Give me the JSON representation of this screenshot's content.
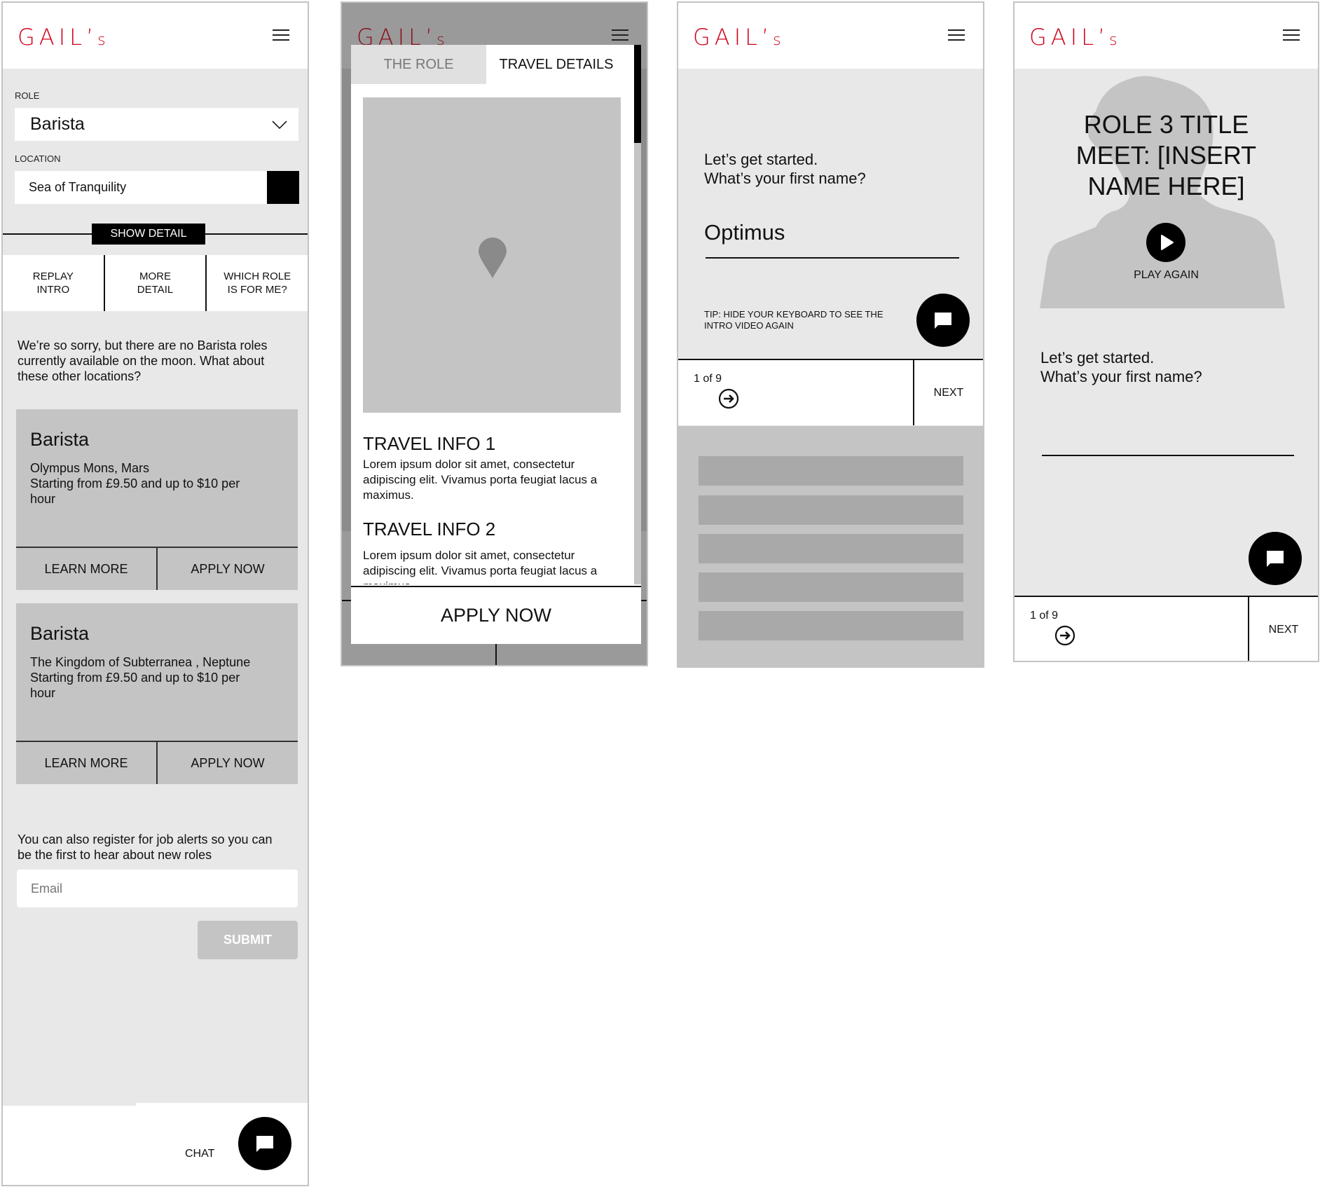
{
  "brand": {
    "logo_main": "GAIL’",
    "logo_suffix": "s",
    "logo_color": "#d0021b"
  },
  "screen1": {
    "role_label": "ROLE",
    "role_value": "Barista",
    "location_label": "LOCATION",
    "location_value": "Sea of Tranquility",
    "show_detail": "SHOW DETAIL",
    "nav": [
      {
        "label": "REPLAY\nINTRO"
      },
      {
        "label": "MORE\nDETAIL"
      },
      {
        "label": "WHICH ROLE\nIS FOR ME?"
      }
    ],
    "sorry_text": "We’re so sorry, but there are no Barista roles currently available on the moon. What about these other locations?",
    "jobs": [
      {
        "title": "Barista",
        "location": "Olympus Mons, Mars",
        "pay": "Starting from £9.50 and up to $10 per hour",
        "learn_more": "LEARN MORE",
        "apply": "APPLY NOW"
      },
      {
        "title": "Barista",
        "location": "The Kingdom of Subterranea , Neptune",
        "pay": "Starting from £9.50 and up to $10 per hour",
        "learn_more": "LEARN MORE",
        "apply": "APPLY NOW"
      }
    ],
    "alerts_text": "You can also register for job alerts so you can be the first to hear about new roles",
    "email_placeholder": "Email",
    "submit": "SUBMIT",
    "chat_label": "CHAT"
  },
  "screen2": {
    "tabs": [
      {
        "label": "THE ROLE",
        "active": false
      },
      {
        "label": "TRAVEL DETAILS",
        "active": true
      }
    ],
    "sections": [
      {
        "title": "TRAVEL INFO 1",
        "body": "Lorem ipsum dolor sit amet, consectetur adipiscing elit. Vivamus porta feugiat lacus a maximus."
      },
      {
        "title": "TRAVEL INFO 2",
        "body": "Lorem ipsum dolor sit amet, consectetur adipiscing elit. Vivamus porta feugiat lacus a maximus."
      }
    ],
    "apply": "APPLY NOW",
    "scroll_position": 0.15
  },
  "screen3": {
    "prompt": "Let’s get started.\nWhat’s your first name?",
    "name_value": "Optimus",
    "tip": "TIP: HIDE YOUR KEYBOARD TO SEE THE INTRO VIDEO AGAIN",
    "progress": "1 of 9",
    "next": "NEXT"
  },
  "screen4": {
    "video_title": "ROLE 3 TITLE\nMEET: [INSERT\nNAME HERE]",
    "play_again": "PLAY AGAIN",
    "prompt": "Let’s get started.\nWhat’s your first name?",
    "name_value": "",
    "progress": "1 of 9",
    "next": "NEXT"
  }
}
